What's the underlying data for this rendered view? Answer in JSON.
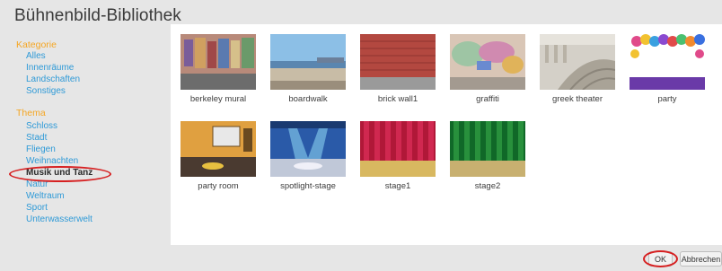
{
  "dialog": {
    "title": "Bühnenbild-Bibliothek"
  },
  "sidebar": {
    "category_heading": "Kategorie",
    "categories": [
      {
        "label": "Alles"
      },
      {
        "label": "Innenräume"
      },
      {
        "label": "Landschaften"
      },
      {
        "label": "Sonstiges"
      }
    ],
    "theme_heading": "Thema",
    "themes": [
      {
        "label": "Schloss"
      },
      {
        "label": "Stadt"
      },
      {
        "label": "Fliegen"
      },
      {
        "label": "Weihnachten"
      },
      {
        "label": "Musik und Tanz",
        "selected": true
      },
      {
        "label": "Natur"
      },
      {
        "label": "Weltraum"
      },
      {
        "label": "Sport"
      },
      {
        "label": "Unterwasserwelt"
      }
    ]
  },
  "backdrops": [
    {
      "label": "berkeley mural"
    },
    {
      "label": "boardwalk"
    },
    {
      "label": "brick wall1"
    },
    {
      "label": "graffiti"
    },
    {
      "label": "greek theater"
    },
    {
      "label": "party"
    },
    {
      "label": "party room"
    },
    {
      "label": "spotlight-stage"
    },
    {
      "label": "stage1"
    },
    {
      "label": "stage2"
    }
  ],
  "footer": {
    "ok_label": "OK",
    "cancel_label": "Abbrechen"
  },
  "colors": {
    "accent_heading": "#f5a623",
    "link": "#2f9ad7",
    "highlight": "#d62021"
  }
}
